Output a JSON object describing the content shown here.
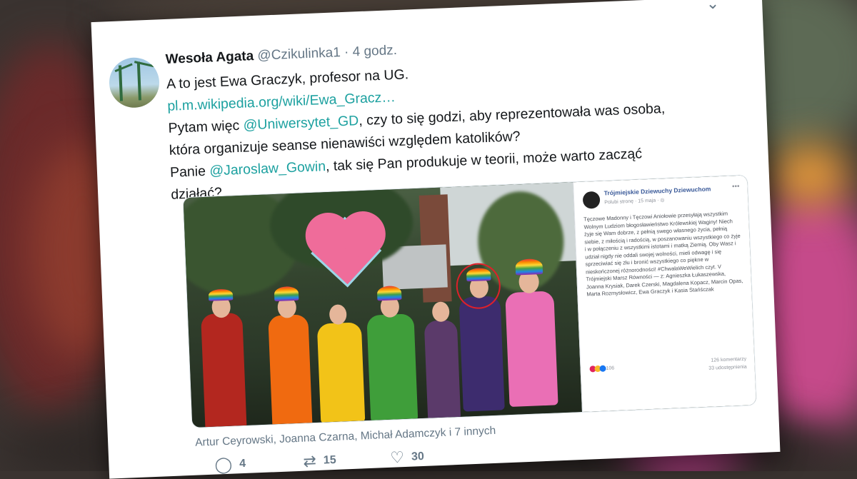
{
  "tweet": {
    "display_name": "Wesoła Agata",
    "handle": "@Czikulinka1",
    "separator": "·",
    "time": "4 godz.",
    "menu_icon": "chevron-down-icon",
    "lines": [
      {
        "parts": [
          {
            "t": "A to jest Ewa Graczyk, profesor na UG.",
            "k": "text"
          }
        ]
      },
      {
        "parts": [
          {
            "t": "pl.m.wikipedia.org/wiki/Ewa_Gracz…",
            "k": "link"
          }
        ]
      },
      {
        "parts": [
          {
            "t": "Pytam więc ",
            "k": "text"
          },
          {
            "t": "@Uniwersytet_GD",
            "k": "mention"
          },
          {
            "t": ", czy to się godzi, aby reprezentowała was osoba,",
            "k": "text"
          }
        ]
      },
      {
        "parts": [
          {
            "t": "która organizuje seanse nienawiści względem katolików?",
            "k": "text"
          }
        ]
      },
      {
        "parts": [
          {
            "t": "Panie ",
            "k": "text"
          },
          {
            "t": "@Jaroslaw_Gowin",
            "k": "mention"
          },
          {
            "t": ", tak się Pan produkuje w teorii, może warto zacząć",
            "k": "text"
          }
        ]
      },
      {
        "parts": [
          {
            "t": "działać?",
            "k": "text"
          }
        ]
      }
    ]
  },
  "embedded_post": {
    "page_name": "Trójmiejskie Dziewuchy Dziewuchom",
    "meta": "Polubi stronę · 15 maja · ◎",
    "menu": "•••",
    "body": "Tęczowe Madonny i Tęczowi Aniołowie przesyłają wszystkim Wolnym Ludziom błogosławieństwo Królewskiej Waginy! Niech żyje się Wam dobrze, z pełnią swego własnego życia, pełnią siebie, z miłością i radością, w poszanowaniu wszystkiego co żyje i w połączeniu z wszystkimi istotami i matką Ziemią. Oby Wasz i udział nigdy nie oddali swojej wolności, mieli odwagę i się sprzeciwiać się złu i bronić wszystkiego co piękne w nieskończonej różnorodności! #ChwalaWeWielich czyt. V Trójmiejski Marsz Równości — z: Agnieszka Łukaszewska, Joanna Krysiak, Darek Czerski, Magdalena Kopacz, Marcin Opas, Marta Rozmysłowicz, Ewa Graczyk i Kasia Stańśczak",
    "reaction_count": "106",
    "comments": "126 komentarzy",
    "shares": "33 udostępnienia"
  },
  "likers": "Artur Ceyrowski, Joanna Czarna, Michał Adamczyk i 7 innych",
  "actions": {
    "reply": {
      "icon": "reply-bubble-icon",
      "glyph": "◯",
      "count": "4"
    },
    "retweet": {
      "icon": "retweet-icon",
      "glyph": "⇄",
      "count": "15"
    },
    "like": {
      "icon": "heart-icon",
      "glyph": "♡",
      "count": "30"
    }
  },
  "colors": {
    "link": "#1da1a0",
    "text": "#14171a",
    "muted": "#657786",
    "highlight_circle": "#e0202a"
  }
}
